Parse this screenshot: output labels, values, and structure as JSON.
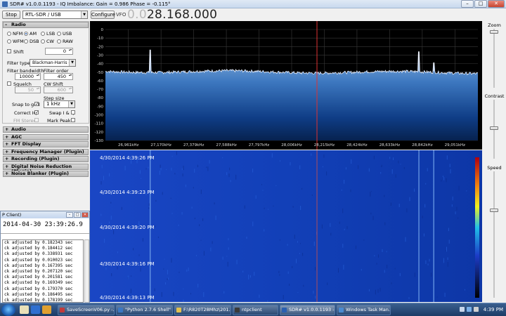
{
  "window": {
    "title": "SDR# v1.0.0.1193 - IQ Imbalance: Gain = 0.986 Phase = -0.115°"
  },
  "toolbar": {
    "stop_label": "Stop",
    "source_value": "RTL-SDR / USB",
    "configure_label": "Configure",
    "vfo_label": "VFO",
    "vfo_prefix": "0.0",
    "vfo_value": "28.168.000"
  },
  "radio": {
    "header": "Radio",
    "modes_row1": [
      "NFM",
      "AM",
      "LSB",
      "USB"
    ],
    "modes_row2": [
      "WFM",
      "DSB",
      "CW",
      "RAW"
    ],
    "selected_mode": "AM",
    "shift_label": "Shift",
    "shift_value": "0",
    "filter_type_label": "Filter type",
    "filter_type_value": "Blackman-Harris 4",
    "filter_bandwidth_label": "Filter bandwidth",
    "filter_bandwidth_value": "10000",
    "filter_order_label": "Filter order",
    "filter_order_value": "450",
    "squelch_label": "Squelch",
    "squelch_value": "50",
    "cw_shift_label": "CW Shift",
    "cw_shift_value": "600",
    "step_size_label": "Step size",
    "step_size_value": "1 kHz",
    "snap_label": "Snap to grid",
    "correct_iq_label": "Correct IQ",
    "swap_iq_label": "Swap I & Q",
    "fm_stereo_label": "FM Stereo",
    "mark_peaks_label": "Mark Peaks"
  },
  "plugins": [
    "Audio",
    "AGC",
    "FFT Display",
    "Frequency Manager (Plugin)",
    "Recording (Plugin)",
    "Digital Noise Reduction (Plugin)",
    "Noise Blanker (Plugin)"
  ],
  "right_panel": {
    "zoom_label": "Zoom",
    "zoom_level": 0.02,
    "contrast_label": "Contrast",
    "contrast_level": 0.48,
    "speed_label": "Speed",
    "speed_level": 0.3
  },
  "chart_data": {
    "type": "line",
    "y_ticks": [
      0,
      -10,
      -20,
      -30,
      -40,
      -50,
      -60,
      -70,
      -80,
      -90,
      -100,
      -110,
      -120,
      -130
    ],
    "ylim": [
      -130,
      0
    ],
    "x_ticks": [
      "26,961kHz",
      "27,170kHz",
      "27,379kHz",
      "27,588kHz",
      "27,797kHz",
      "28,006kHz",
      "28,215kHz",
      "28,424kHz",
      "28,633kHz",
      "28,842kHz",
      "29,051kHz"
    ],
    "x_tick_values_khz": [
      26961,
      27170,
      27379,
      27588,
      27797,
      28006,
      28215,
      28424,
      28633,
      28842,
      29051
    ],
    "xlim_khz": [
      26814,
      29198
    ],
    "noise_floor_db": -49,
    "peaks": [
      {
        "x_khz": 27100,
        "y_db": -24
      },
      {
        "x_khz": 28820,
        "y_db": -26
      },
      {
        "x_khz": 28915,
        "y_db": -39
      }
    ],
    "tuned_khz": 28168,
    "grid": true
  },
  "waterfall": {
    "timestamps": [
      "4/30/2014 4:39:26 PM",
      "4/30/2014 4:39:23 PM",
      "4/30/2014 4:39:20 PM",
      "4/30/2014 4:39:16 PM",
      "4/30/2014 4:39:13 PM"
    ]
  },
  "ntp": {
    "title": "P Client)",
    "datetime": "2014-04-30 23:39:26.9",
    "log_lines": [
      "ck adjusted by 0.182343 sec",
      "ck adjusted by 0.184412 sec",
      "ck adjusted by 0.338931 sec",
      "ck adjusted by 0.010023 sec",
      "ck adjusted by 0.167395 sec",
      "ck adjusted by 0.207120 sec",
      "ck adjusted by 0.201581 sec",
      "ck adjusted by 0.169349 sec",
      "ck adjusted by 0.179370 sec",
      "ck adjusted by 0.186495 sec",
      "ck adjusted by 0.178199 sec"
    ]
  },
  "taskbar": {
    "tasks": [
      "SaveScreenV06.py -...",
      "\"Python 2.7.6 Shell\"",
      "F:\\R820T28Mhz\\201...",
      "ntpclient",
      "SDR# v1.0.0.1193 - ...",
      "Windows Task Man..."
    ],
    "clock": "4:39 PM"
  }
}
